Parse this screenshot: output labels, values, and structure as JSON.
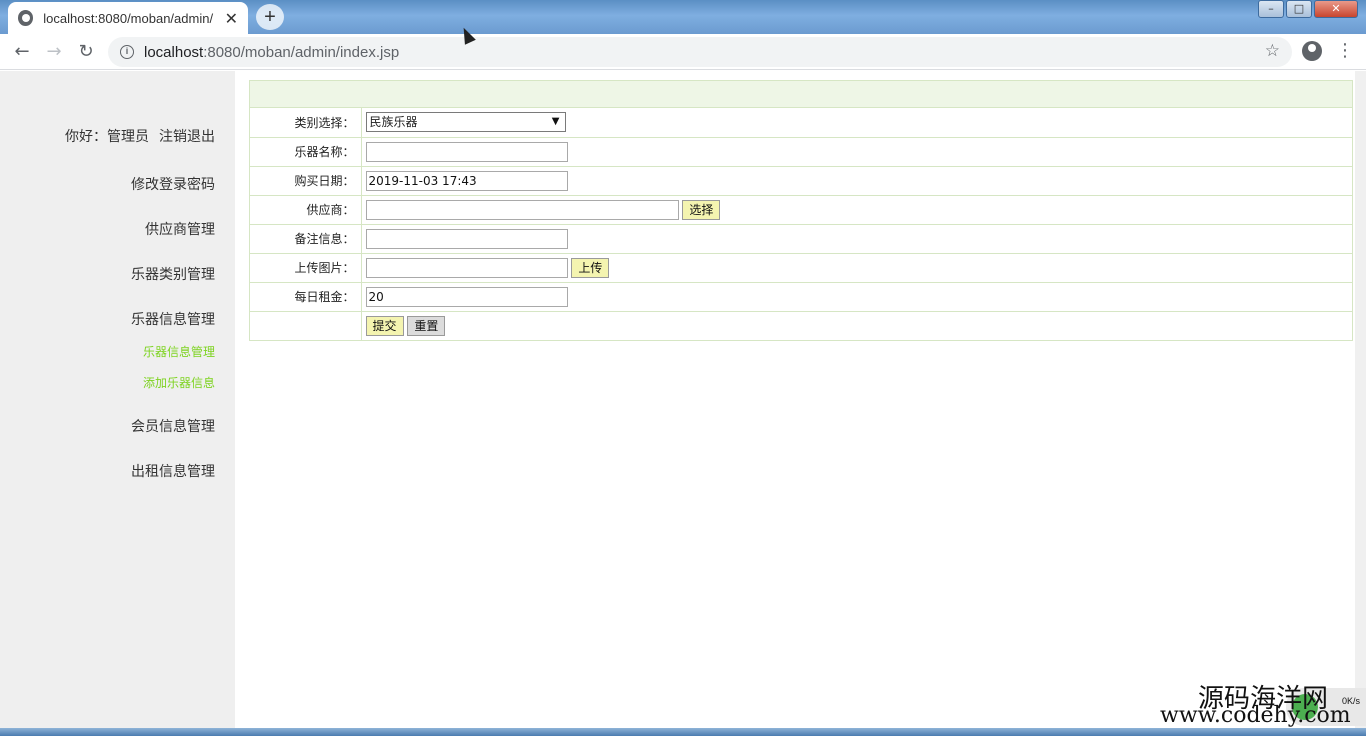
{
  "browser": {
    "tab_title": "localhost:8080/moban/admin/",
    "tab_close": "✕",
    "new_tab": "+",
    "url_host": "localhost",
    "url_path": ":8080/moban/admin/index.jsp",
    "back": "←",
    "forward": "→",
    "reload": "↻",
    "star": "☆",
    "menu": "⋮"
  },
  "sidebar": {
    "greeting": "你好：管理员",
    "logout": "注销退出",
    "items": [
      {
        "label": "修改登录密码"
      },
      {
        "label": "供应商管理"
      },
      {
        "label": "乐器类别管理"
      },
      {
        "label": "乐器信息管理"
      },
      {
        "label": "会员信息管理"
      },
      {
        "label": "出租信息管理"
      }
    ],
    "subitems": [
      {
        "label": "乐器信息管理"
      },
      {
        "label": "添加乐器信息"
      }
    ]
  },
  "form": {
    "category_label": "类别选择：",
    "category_value": "民族乐器",
    "name_label": "乐器名称：",
    "name_value": "",
    "date_label": "购买日期：",
    "date_value": "2019-11-03 17:43",
    "supplier_label": "供应商：",
    "supplier_value": "",
    "choose_label": "选择",
    "remark_label": "备注信息：",
    "remark_value": "",
    "image_label": "上传图片：",
    "image_value": "",
    "upload_label": "上传",
    "rent_label": "每日租金：",
    "rent_value": "20",
    "submit_label": "提交",
    "reset_label": "重置"
  },
  "watermark": {
    "line1": "源码海洋网",
    "line2": "www.codehy.com",
    "speed": "0K/s"
  },
  "colors": {
    "sidebar_bg": "#efefef",
    "submenu_text": "#7ed321",
    "form_border": "#d6e6c4",
    "form_header_bg": "#eef6e6",
    "button_bg": "#f4f4b0"
  }
}
